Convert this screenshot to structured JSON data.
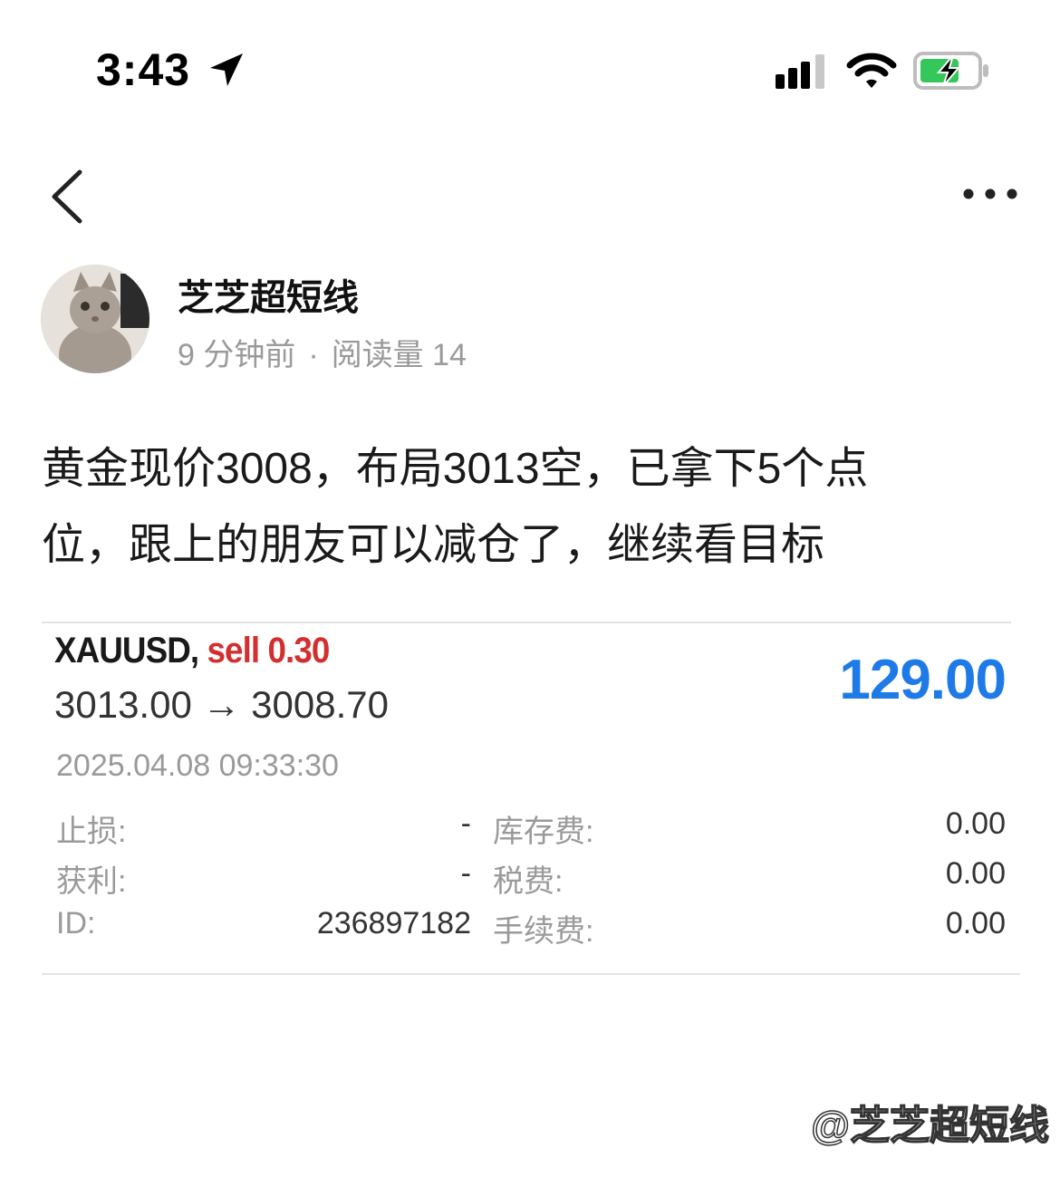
{
  "status_bar": {
    "time": "3:43",
    "icons": [
      "location-arrow-icon",
      "cellular-signal-icon",
      "wifi-icon",
      "battery-charging-icon"
    ]
  },
  "nav": {
    "back_icon": "back-chevron-icon",
    "more_icon": "more-dots-icon"
  },
  "author": {
    "name": "芝芝超短线",
    "time_ago": "9 分钟前",
    "separator": "·",
    "reads": "阅读量 14"
  },
  "post": {
    "line1": "黄金现价3008，布局3013空，已拿下5个点",
    "line2": "位，跟上的朋友可以减仓了，继续看目标"
  },
  "trade": {
    "symbol": "XAUUSD,",
    "side": "sell 0.30",
    "prices": "3013.00 → 3008.70",
    "profit": "129.00",
    "datetime": "2025.04.08 09:33:30",
    "rows": [
      {
        "label_left": "止损:",
        "value_left": "-",
        "label_right": "库存费:",
        "value_right": "0.00"
      },
      {
        "label_left": "获利:",
        "value_left": "-",
        "label_right": "税费:",
        "value_right": "0.00"
      },
      {
        "label_left": "ID:",
        "value_left": "236897182",
        "label_right": "手续费:",
        "value_right": "0.00"
      }
    ]
  },
  "watermark": "@芝芝超短线",
  "colors": {
    "sell": "#d32f2f",
    "profit": "#1e7ae6",
    "battery_fill": "#34c759"
  }
}
